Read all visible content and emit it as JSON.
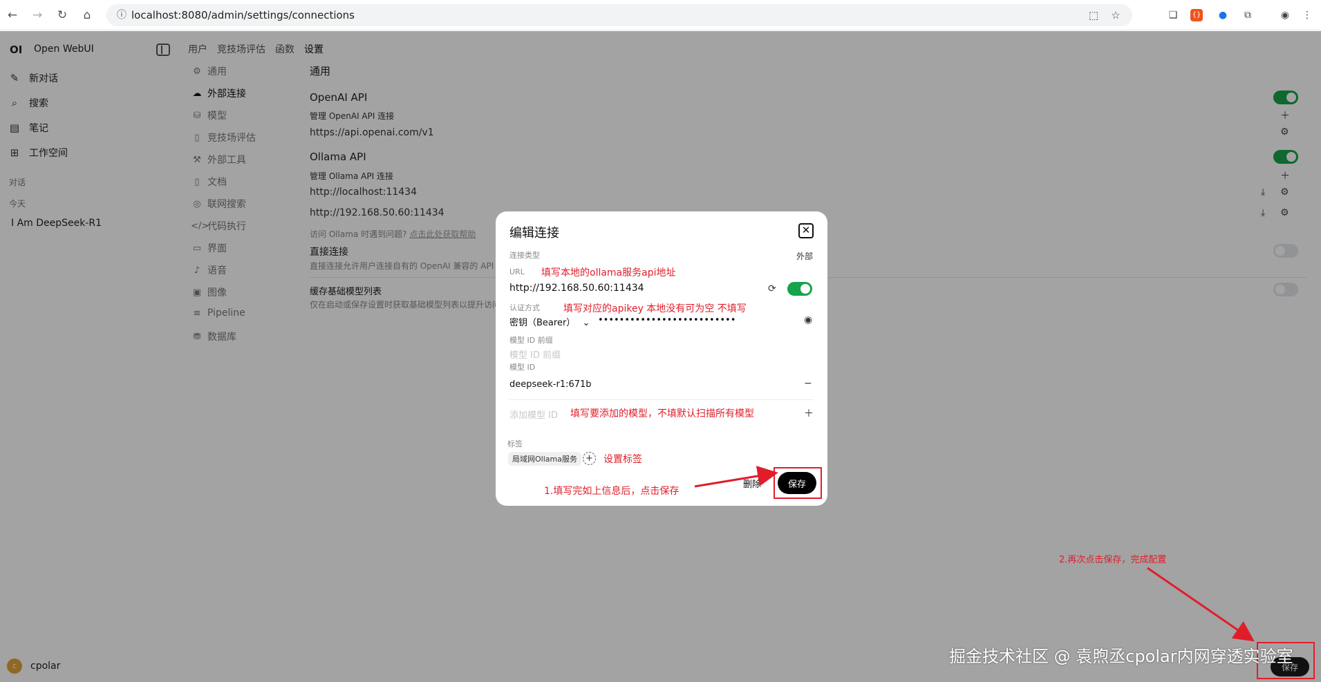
{
  "browser": {
    "url": "localhost:8080/admin/settings/connections"
  },
  "sidebar": {
    "brand": "OI",
    "app_name": "Open WebUI",
    "items": [
      {
        "label": "新对话"
      },
      {
        "label": "搜索"
      },
      {
        "label": "笔记"
      },
      {
        "label": "工作空间"
      }
    ],
    "section_label": "对话",
    "today_label": "今天",
    "chat_title": "I Am DeepSeek-R1",
    "user": {
      "initial": "c",
      "name": "cpolar"
    }
  },
  "settings": {
    "tabs": [
      "用户",
      "竞技场评估",
      "函数",
      "设置"
    ],
    "nav": [
      {
        "label": "通用"
      },
      {
        "label": "外部连接"
      },
      {
        "label": "模型"
      },
      {
        "label": "竞技场评估"
      },
      {
        "label": "外部工具"
      },
      {
        "label": "文档"
      },
      {
        "label": "联网搜索"
      },
      {
        "label": "代码执行"
      },
      {
        "label": "界面"
      },
      {
        "label": "语音"
      },
      {
        "label": "图像"
      },
      {
        "label": "Pipeline"
      },
      {
        "label": "数据库"
      }
    ],
    "content": {
      "section_title": "通用",
      "openai_title": "OpenAI API",
      "openai_sub": "管理 OpenAI API 连接",
      "openai_url": "https://api.openai.com/v1",
      "ollama_title": "Ollama API",
      "ollama_sub": "管理 Ollama API 连接",
      "ollama_url_1": "http://localhost:11434",
      "ollama_url_2": "http://192.168.50.60:11434",
      "ollama_hint": "访问 Ollama 时遇到问题?",
      "ollama_hint_link": "点击此处获取帮助",
      "direct_title": "直接连接",
      "direct_desc": "直接连接允许用户连接自有的 OpenAI 兼容的 API",
      "cache_title": "缓存基础模型列表",
      "cache_desc": "仅在启动或保存设置时获取基础模型列表以提升访问"
    },
    "save_label": "保存"
  },
  "modal": {
    "title": "编辑连接",
    "connection_type_label": "连接类型",
    "connection_type_value": "外部",
    "url_label": "URL",
    "url_value": "http://192.168.50.60:11434",
    "auth_label": "认证方式",
    "auth_method": "密钥（Bearer）",
    "auth_key": "••••••••••••••••••••••••••",
    "prefix_label": "模型 ID 前缀",
    "prefix_placeholder": "模型 ID 前缀",
    "model_id_label": "模型 ID",
    "model_id_value": "deepseek-r1:671b",
    "add_model_placeholder": "添加模型 ID",
    "tags_label": "标签",
    "tag_value": "局域网Ollama服务",
    "delete_label": "删除",
    "save_label": "保存"
  },
  "annotations": {
    "url_note": "填写本地的ollama服务api地址",
    "auth_note": "填写对应的apikey 本地没有可为空 不填写",
    "model_note": "填写要添加的模型，不填默认扫描所有模型",
    "tag_note": "设置标签",
    "step1_note": "1.填写完如上信息后，点击保存",
    "step2_note": "2.再次点击保存，完成配置"
  },
  "watermark": "掘金技术社区 @ 袁煦丞cpolar内网穿透实验室",
  "colors": {
    "accent_green": "#16a34a",
    "annotation_red": "#e11d2a",
    "save_black": "#000000"
  }
}
